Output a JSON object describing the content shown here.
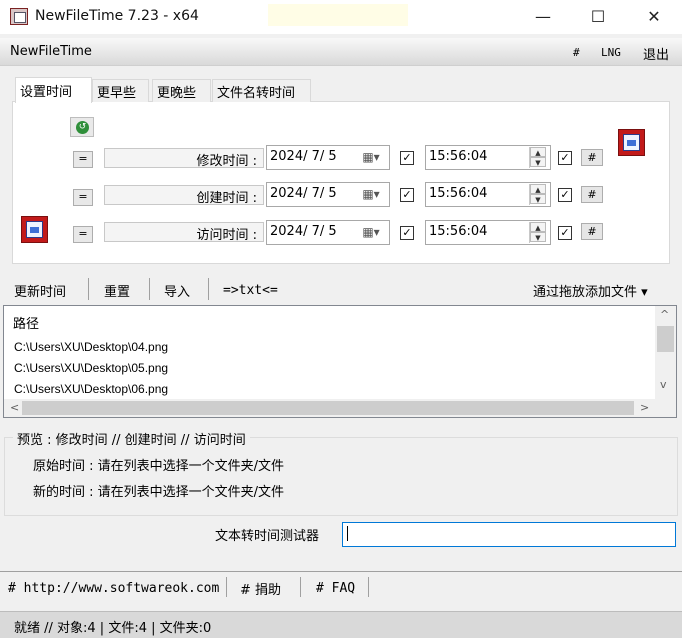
{
  "window": {
    "title": "NewFileTime 7.23 - x64",
    "minimize_glyph": "—",
    "maximize_glyph": "☐",
    "close_glyph": "✕"
  },
  "menubar": {
    "brand": "NewFileTime",
    "hash": "#",
    "lng": "LNG",
    "exit": "退出"
  },
  "tabs": [
    "设置时间",
    "更早些",
    "更晚些",
    "文件名转时间"
  ],
  "time_rows": [
    {
      "eq": "=",
      "label": "修改时间 :",
      "date": "2024/ 7/ 5",
      "time": "15:56:04",
      "hash": "#",
      "date_checked": true,
      "time_checked": true
    },
    {
      "eq": "=",
      "label": "创建时间 :",
      "date": "2024/ 7/ 5",
      "time": "15:56:04",
      "hash": "#",
      "date_checked": true,
      "time_checked": true
    },
    {
      "eq": "=",
      "label": "访问时间 :",
      "date": "2024/ 7/ 5",
      "time": "15:56:04",
      "hash": "#",
      "date_checked": true,
      "time_checked": true
    }
  ],
  "toolbar": {
    "update": "更新时间",
    "reset": "重置",
    "import": "导入",
    "txt": "=>txt<=",
    "add_by_drag": "通过拖放添加文件 ▾"
  },
  "file_list": {
    "header": "路径",
    "rows": [
      "C:\\Users\\XU\\Desktop\\04.png",
      "C:\\Users\\XU\\Desktop\\05.png",
      "C:\\Users\\XU\\Desktop\\06.png"
    ]
  },
  "preview": {
    "legend": "预览 :  修改时间  //  创建时间  //  访问时间",
    "original": "原始时间 : 请在列表中选择一个文件夹/文件",
    "new": "新的时间 : 请在列表中选择一个文件夹/文件"
  },
  "tester": {
    "label": "文本转时间测试器",
    "value": ""
  },
  "bottom": {
    "website": "# http://www.softwareok.com",
    "donate": "# 捐助",
    "faq": "# FAQ"
  },
  "status": "就绪 // 对象:4 | 文件:4  | 文件夹:0"
}
